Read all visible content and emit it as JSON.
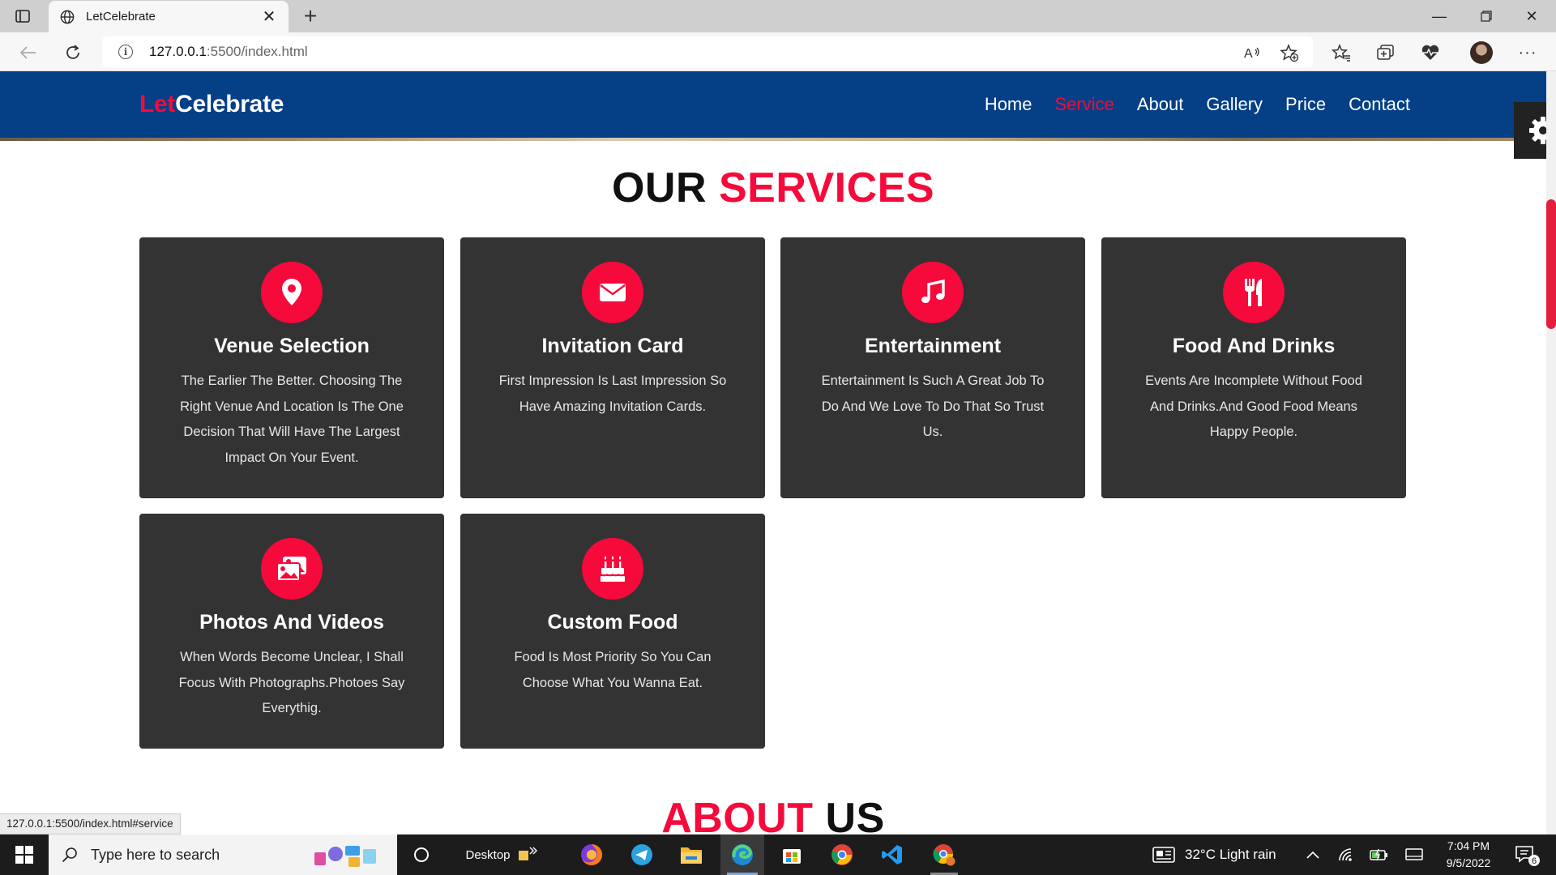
{
  "browser": {
    "tab_title": "LetCelebrate",
    "url_host": "127.0.0.1",
    "url_path": ":5500/index.html",
    "status_url": "127.0.0.1:5500/index.html#service"
  },
  "site": {
    "logo_accent": "Let",
    "logo_main": "Celebrate",
    "accent_color": "#f50a3b",
    "nav_color": "#053f86",
    "nav": [
      {
        "label": "Home",
        "active": false
      },
      {
        "label": "Service",
        "active": true
      },
      {
        "label": "About",
        "active": false
      },
      {
        "label": "Gallery",
        "active": false
      },
      {
        "label": "Price",
        "active": false
      },
      {
        "label": "Contact",
        "active": false
      }
    ]
  },
  "services_section": {
    "title_main": "OUR",
    "title_accent": "SERVICES",
    "cards": [
      {
        "icon": "map-marker-icon",
        "title": "Venue Selection",
        "text": "The Earlier The Better. Choosing The Right Venue And Location Is The One Decision That Will Have The Largest Impact On Your Event."
      },
      {
        "icon": "envelope-icon",
        "title": "Invitation Card",
        "text": "First Impression Is Last Impression So Have Amazing Invitation Cards."
      },
      {
        "icon": "music-icon",
        "title": "Entertainment",
        "text": "Entertainment Is Such A Great Job To Do And We Love To Do That So Trust Us."
      },
      {
        "icon": "utensils-icon",
        "title": "Food And Drinks",
        "text": "Events Are Incomplete Without Food And Drinks.And Good Food Means Happy People."
      },
      {
        "icon": "photo-video-icon",
        "title": "Photos And Videos",
        "text": "When Words Become Unclear, I Shall Focus With Photographs.Photoes Say Everythig."
      },
      {
        "icon": "birthday-cake-icon",
        "title": "Custom Food",
        "text": "Food Is Most Priority So You Can Choose What You Wanna Eat."
      }
    ]
  },
  "about_section": {
    "title_accent": "ABOUT",
    "title_main": "US"
  },
  "taskbar": {
    "search_placeholder": "Type here to search",
    "desktop_label": "Desktop",
    "weather": "32°C  Light rain",
    "time": "7:04 PM",
    "date": "9/5/2022",
    "notification_count": "6"
  }
}
